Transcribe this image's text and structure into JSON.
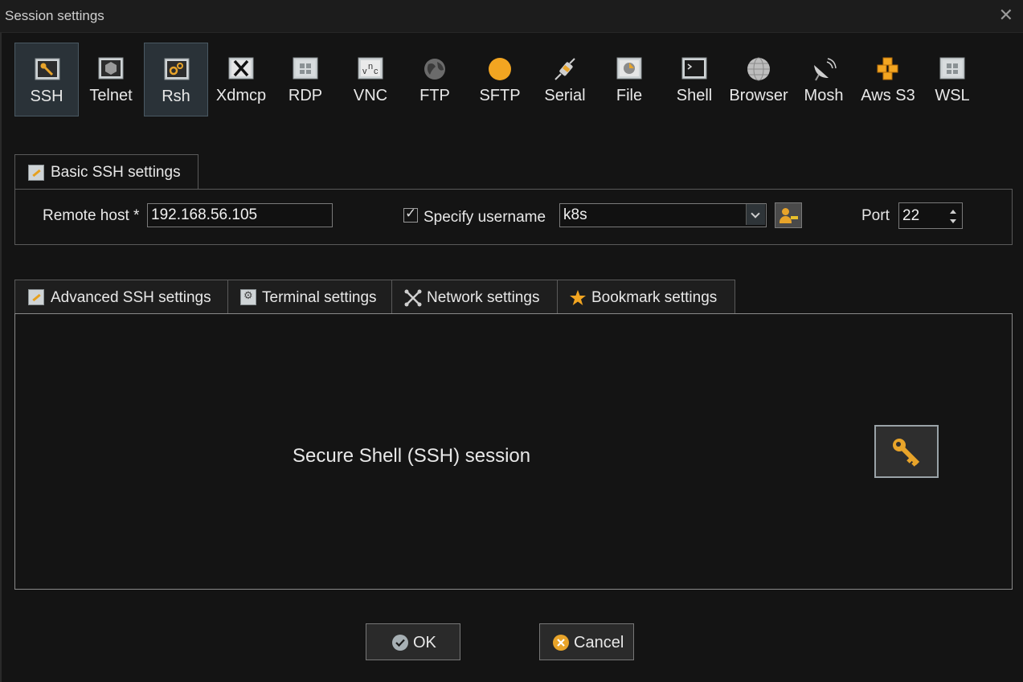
{
  "window": {
    "title": "Session settings",
    "close_glyph": "✕"
  },
  "protocols": [
    {
      "label": "SSH",
      "icon": "ssh-key-icon",
      "selected": true
    },
    {
      "label": "Telnet",
      "icon": "telnet-icon",
      "selected": false
    },
    {
      "label": "Rsh",
      "icon": "rsh-gears-icon",
      "selected": true
    },
    {
      "label": "Xdmcp",
      "icon": "x-logo-icon",
      "selected": false
    },
    {
      "label": "RDP",
      "icon": "rdp-window-icon",
      "selected": false
    },
    {
      "label": "VNC",
      "icon": "vnc-icon",
      "selected": false
    },
    {
      "label": "FTP",
      "icon": "globe-icon",
      "selected": false
    },
    {
      "label": "SFTP",
      "icon": "orange-circle-icon",
      "selected": false
    },
    {
      "label": "Serial",
      "icon": "serial-plug-icon",
      "selected": false
    },
    {
      "label": "File",
      "icon": "file-monitor-icon",
      "selected": false
    },
    {
      "label": "Shell",
      "icon": "shell-prompt-icon",
      "selected": false
    },
    {
      "label": "Browser",
      "icon": "globe-gray-icon",
      "selected": false
    },
    {
      "label": "Mosh",
      "icon": "satellite-dish-icon",
      "selected": false
    },
    {
      "label": "Aws S3",
      "icon": "aws-cubes-icon",
      "selected": false
    },
    {
      "label": "WSL",
      "icon": "windows-logo-icon",
      "selected": false
    }
  ],
  "basic": {
    "tab_label": "Basic SSH settings",
    "remote_host_label": "Remote host *",
    "remote_host_value": "192.168.56.105",
    "specify_username_label": "Specify username",
    "specify_username_checked": true,
    "username_value": "k8s",
    "port_label": "Port",
    "port_value": "22"
  },
  "tabs": [
    {
      "label": "Advanced SSH settings",
      "icon": "key-icon"
    },
    {
      "label": "Terminal settings",
      "icon": "gear-icon"
    },
    {
      "label": "Network settings",
      "icon": "network-icon"
    },
    {
      "label": "Bookmark settings",
      "icon": "star-icon"
    }
  ],
  "panel": {
    "description": "Secure Shell (SSH) session"
  },
  "buttons": {
    "ok": "OK",
    "cancel": "Cancel"
  },
  "colors": {
    "accent_orange": "#e8a42a",
    "background": "#141414",
    "selected_bg": "#2a3238",
    "ok_icon": "#a7b0b4",
    "cancel_icon": "#e8a42a"
  }
}
